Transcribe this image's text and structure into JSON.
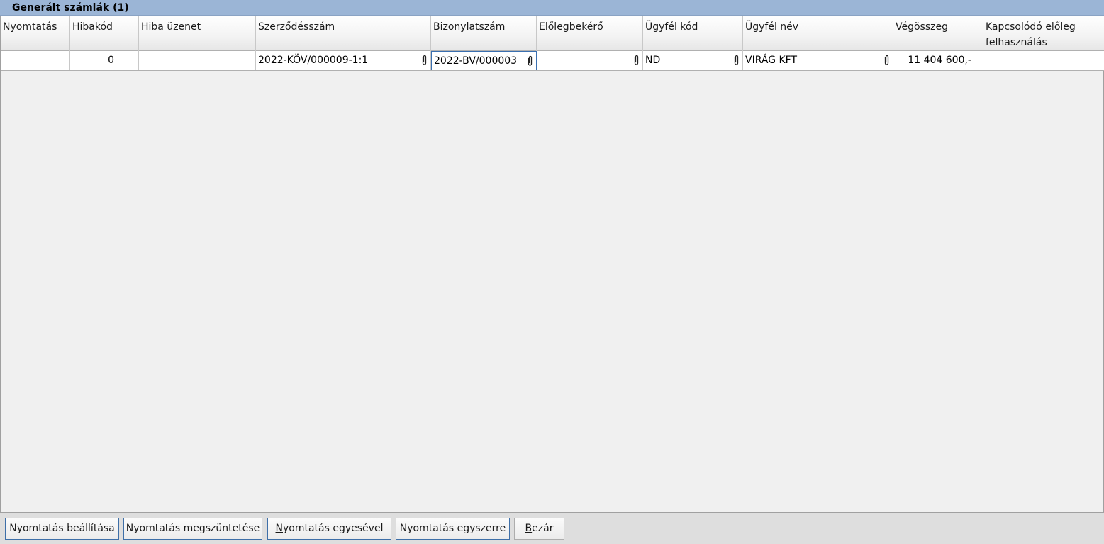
{
  "panel": {
    "title": "Generált számlák (1)"
  },
  "columns": [
    "Nyomtatás",
    "Hibakód",
    "Hiba üzenet",
    "Szerződésszám",
    "Bizonylatszám",
    "Előlegbekérő",
    "Ügyfél kód",
    "Ügyfél név",
    "Végösszeg",
    "Kapcsolódó előleg felhasználás"
  ],
  "rows": [
    {
      "nyomtatas_checked": false,
      "hibakod": "0",
      "hiba_uzenet": "",
      "szerzodesszam": "2022-KÖV/000009-1:1",
      "bizonylatszam": "2022-BV/000003",
      "eloleg_bekero": "",
      "ugyfel_kod": "ND",
      "ugyfel_nev": "VIRÁG KFT",
      "vegosszeg": "11 404 600,-",
      "kapcsolodo_eloleg": ""
    }
  ],
  "buttons": {
    "print_settings": "Nyomtatás beállítása",
    "cancel_print": "Nyomtatás megszüntetése",
    "print_one_first": "N",
    "print_one_rest": "yomtatás egyesével",
    "print_all": "Nyomtatás egyszerre",
    "close_first": "B",
    "close_rest": "ezár"
  },
  "icons": {
    "attachment": "paperclip-icon"
  },
  "colors": {
    "title_bar": "#9bb5d6",
    "focus_border": "#3a6fb0"
  }
}
